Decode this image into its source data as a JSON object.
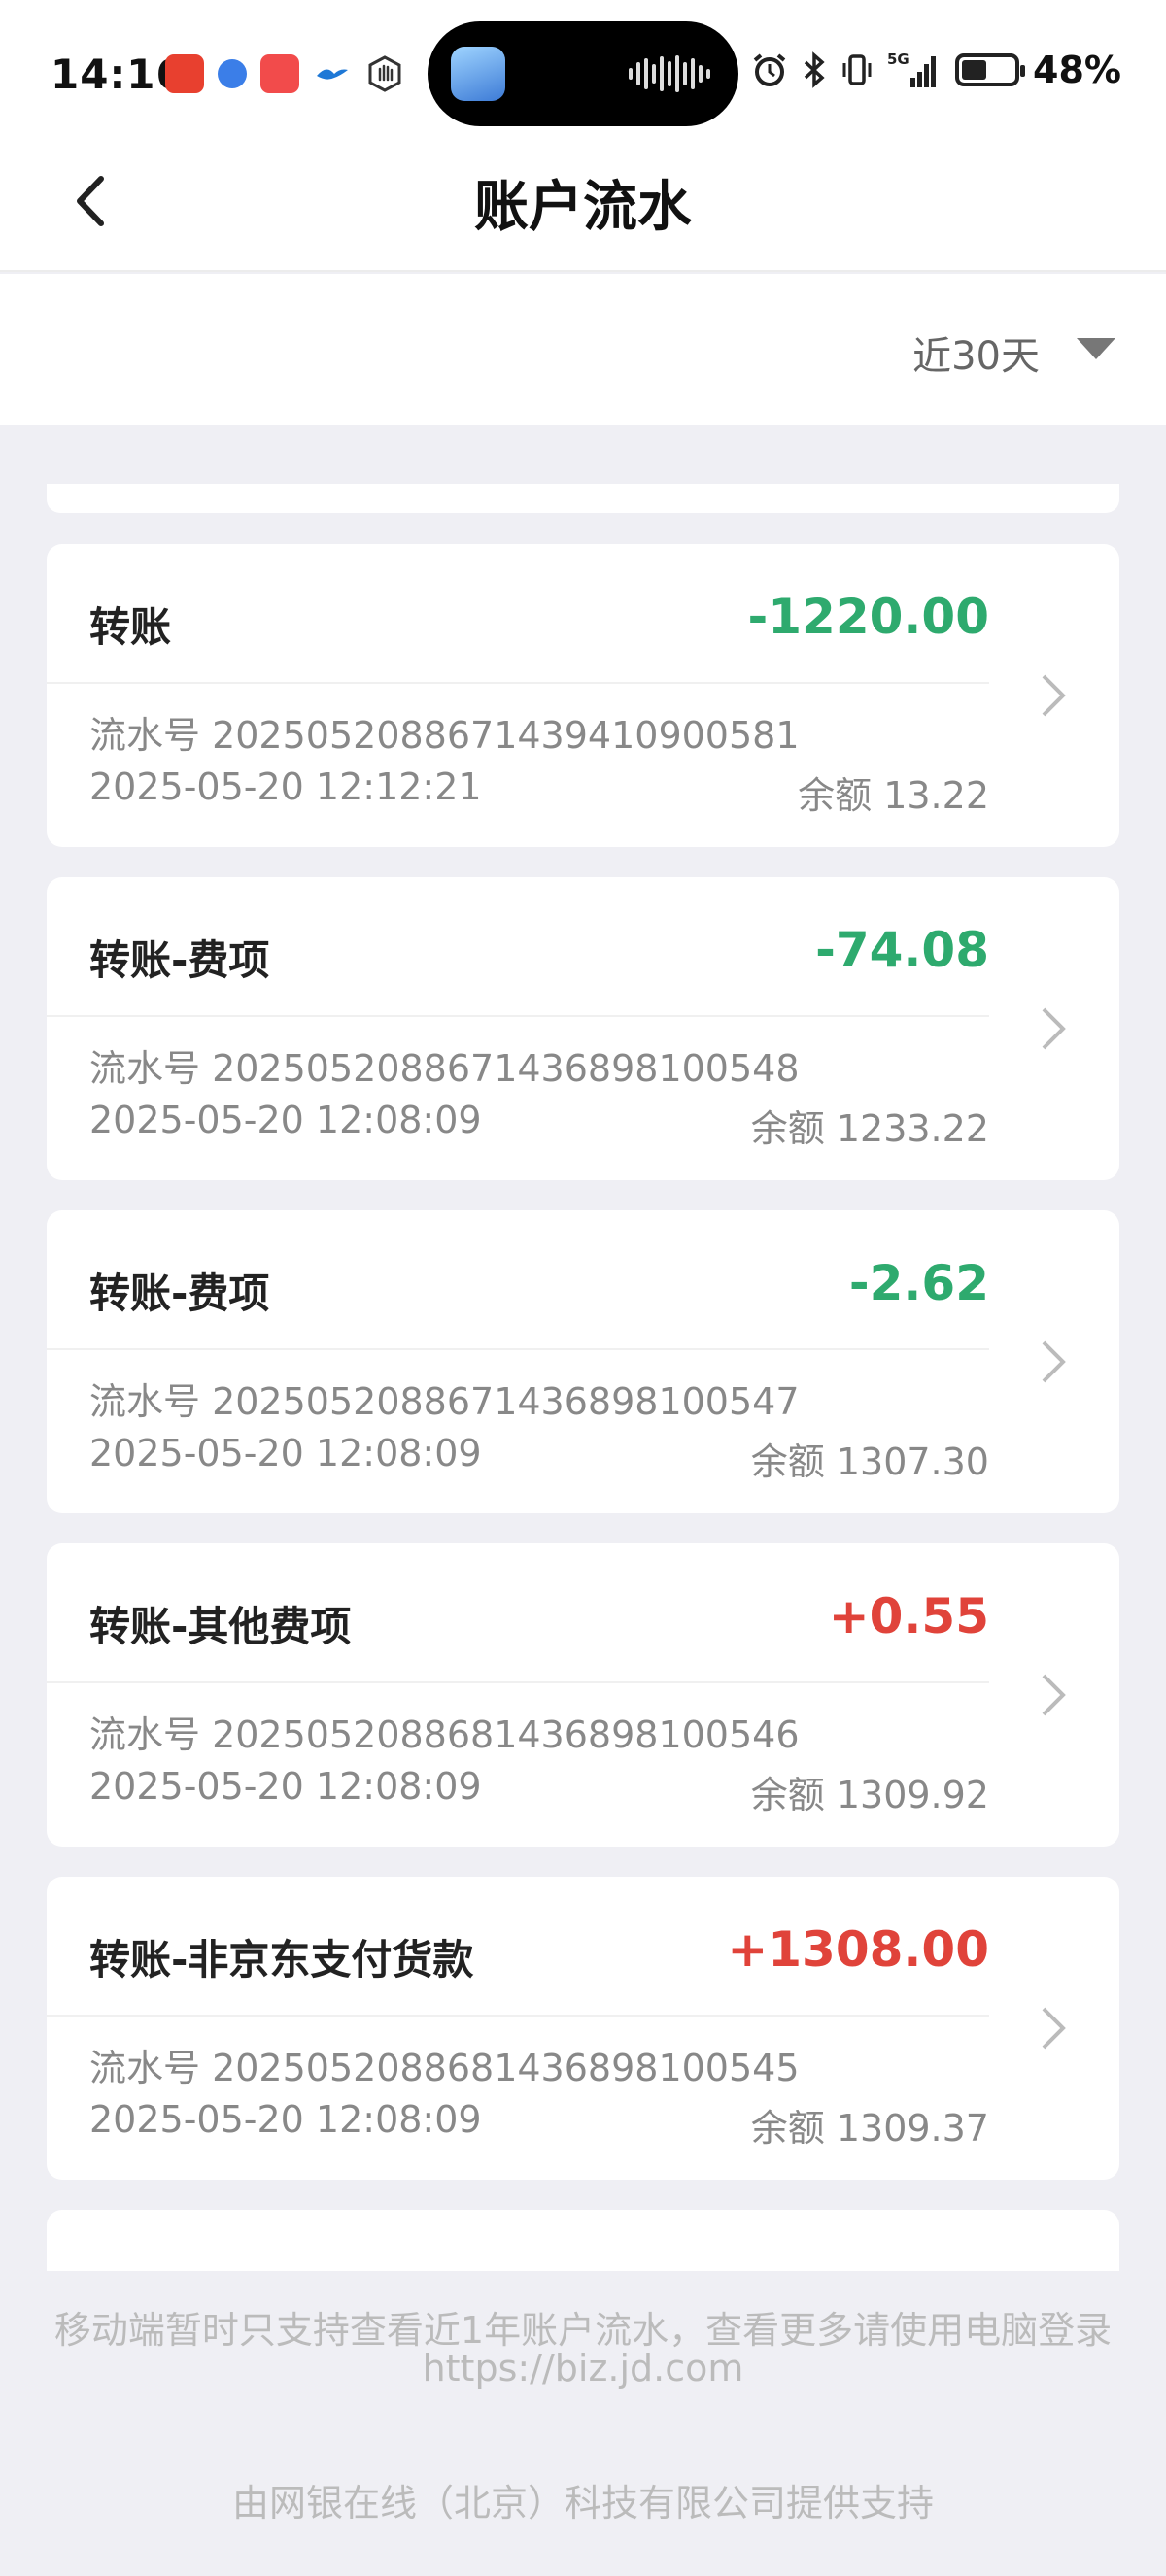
{
  "status_bar": {
    "time": "14:16",
    "battery": "48%",
    "battery_level": 0.48,
    "network": "5G"
  },
  "header": {
    "title": "账户流水"
  },
  "filter": {
    "range_label": "近30天"
  },
  "transactions": [
    {
      "title": "转账",
      "amount": "-1220.00",
      "serial": "流水号 2025052088671439410900581",
      "time": "2025-05-20 12:12:21",
      "balance": "余额 13.22"
    },
    {
      "title": "转账-费项",
      "amount": "-74.08",
      "serial": "流水号 2025052088671436898100548",
      "time": "2025-05-20 12:08:09",
      "balance": "余额 1233.22"
    },
    {
      "title": "转账-费项",
      "amount": "-2.62",
      "serial": "流水号 2025052088671436898100547",
      "time": "2025-05-20 12:08:09",
      "balance": "余额 1307.30"
    },
    {
      "title": "转账-其他费项",
      "amount": "+0.55",
      "serial": "流水号 2025052088681436898100546",
      "time": "2025-05-20 12:08:09",
      "balance": "余额 1309.92"
    },
    {
      "title": "转账-非京东支付货款",
      "amount": "+1308.00",
      "serial": "流水号 2025052088681436898100545",
      "time": "2025-05-20 12:08:09",
      "balance": "余额 1309.37"
    }
  ],
  "footer": {
    "notice": "移动端暂时只支持查看近1年账户流水，查看更多请使用电脑登录",
    "url": "https://biz.jd.com",
    "provider": "由网银在线（北京）科技有限公司提供支持"
  },
  "colors": {
    "negative": "#2eaa6e",
    "positive": "#e0433a",
    "background": "#efeff4"
  }
}
